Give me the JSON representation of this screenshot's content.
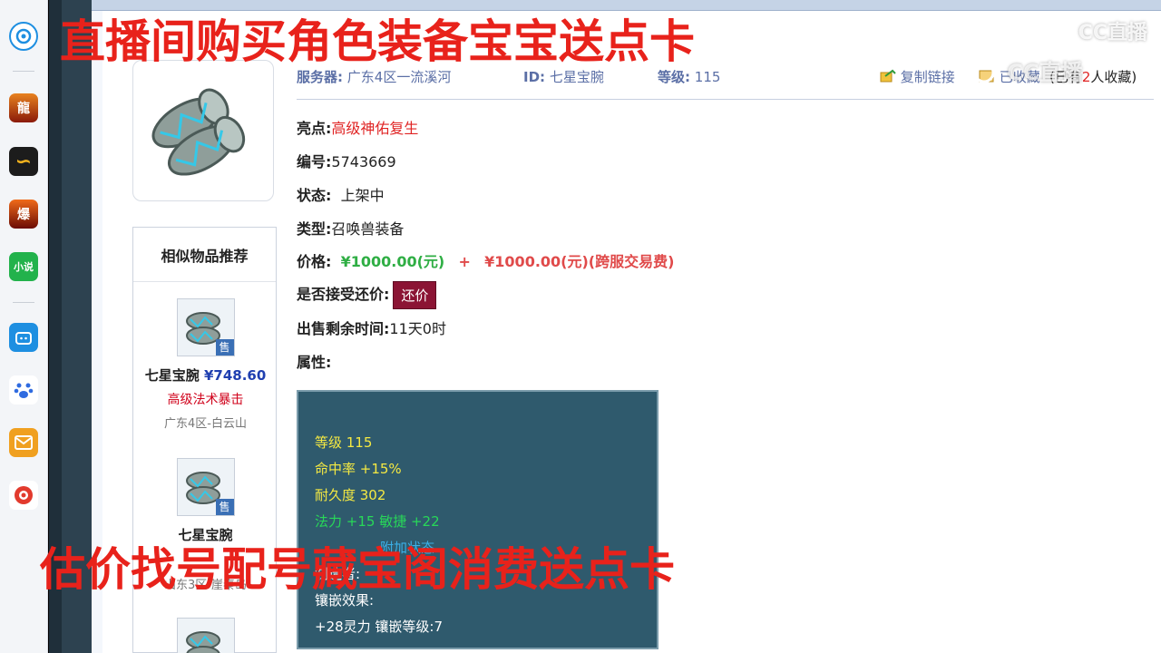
{
  "sidebar": {
    "icons": [
      {
        "name": "browser-icon",
        "color": "#1e8fe1"
      },
      {
        "name": "game-dragon-icon",
        "color": "#b8320f"
      },
      {
        "name": "game-snake-icon",
        "color": "#e2a010"
      },
      {
        "name": "game-burst-icon",
        "color": "#8a1a0a",
        "label": "爆"
      },
      {
        "name": "novel-icon",
        "color": "#22b24c",
        "label": "小说"
      },
      {
        "name": "bilibili-tv-icon",
        "color": "#1e8fe1"
      },
      {
        "name": "baidu-paw-icon",
        "color": "#2f6be0"
      },
      {
        "name": "mail-icon",
        "color": "#f0a020"
      },
      {
        "name": "netease-icon",
        "color": "#e23a2d"
      }
    ]
  },
  "header": {
    "server_label": "服务器:",
    "server_value": "广东4区一流溪河",
    "id_label": "ID:",
    "id_value": "七星宝腕",
    "level_label": "等级:",
    "level_value": "115",
    "copy_link": "复制链接",
    "favorited": "已收藏",
    "fav_count_prefix": "(已有",
    "fav_count": "2",
    "fav_count_suffix": "人收藏)"
  },
  "details": {
    "highlight_label": "亮点:",
    "highlight_value": "高级神佑复生",
    "number_label": "编号:",
    "number_value": "5743669",
    "status_label": "状态:",
    "status_value": "上架中",
    "type_label": "类型:",
    "type_value": "召唤兽装备",
    "price_label": "价格:",
    "price_value": "¥1000.00(元)",
    "price_plus": "+",
    "fee_value": "¥1000.00(元)(跨服交易费)",
    "counter_label": "是否接受还价:",
    "counter_button": "还价",
    "remaining_label": "出售剩余时间:",
    "remaining_value": "11天0时",
    "attrs_label": "属性:"
  },
  "attributes": {
    "level": "等级 115",
    "hit": "命中率 +15%",
    "durability": "耐久度 302",
    "stats": "法力 +15 敏捷 +22",
    "special": "附加状态",
    "maker_label": "制造者:",
    "inlay_label": "镶嵌效果:",
    "inlay_value": "+28灵力 镶嵌等级:7"
  },
  "similar": {
    "title": "相似物品推荐",
    "badge": "售",
    "items": [
      {
        "name": "七星宝腕",
        "price": "¥748.60",
        "highlight": "高级法术暴击",
        "server": "广东4区-白云山"
      },
      {
        "name": "七星宝腕",
        "server": "山东3区-崖秦岛"
      },
      {
        "name": ""
      }
    ]
  },
  "overlays": {
    "top": "直播间购买角色装备宝宝送点卡",
    "bottom": "估价找号配号藏宝阁消费送点卡",
    "watermark": "CC直播"
  }
}
